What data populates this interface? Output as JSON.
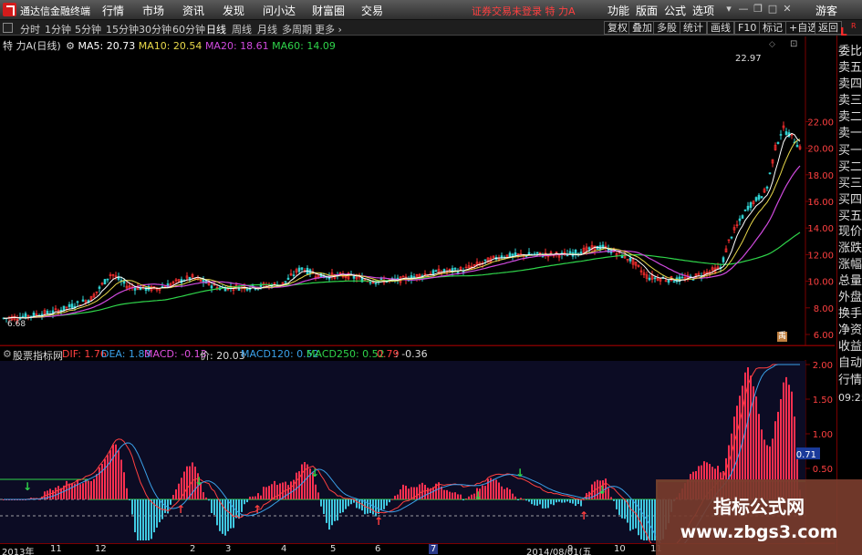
{
  "app": {
    "title": "通达信金融终端"
  },
  "menu": [
    "行情",
    "市场",
    "资讯",
    "发现",
    "问小达",
    "财富圈",
    "交易"
  ],
  "notice": "证券交易未登录  特 力A",
  "right_menu": [
    "功能",
    "版面",
    "公式",
    "选项"
  ],
  "guest": "游客",
  "periods": [
    "分时",
    "1分钟",
    "5分钟",
    "15分钟",
    "30分钟",
    "60分钟",
    "日线",
    "周线",
    "月线",
    "多周期",
    "更多 ›"
  ],
  "active_period": "日线",
  "right_tools": [
    "复权",
    "叠加",
    "多股",
    "统计",
    "画线",
    "F10",
    "标记",
    "+自选",
    "返回"
  ],
  "stock": {
    "name": "特 力A",
    "period_label": "(日线)",
    "ma5": "MA5: 20.73",
    "ma10": "MA10: 20.54",
    "ma20": "MA20: 18.61",
    "ma60": "MA60: 14.09"
  },
  "price_axis": [
    "22.00",
    "20.00",
    "18.00",
    "16.00",
    "14.00",
    "12.00",
    "10.00",
    "8.00",
    "6.00"
  ],
  "annotations": {
    "high": "22.97",
    "low": "6.68"
  },
  "indicator": {
    "name": "股票指标网",
    "dif": "DIF: 1.76",
    "dea": "DEA: 1.83",
    "macd": "MACD: -0.13",
    "price": "价: 20.03",
    "macd120": "MACD120: 0.52",
    "macd250": "MACD250: 0.52",
    "v1": "0.79",
    "v2": ": -0.36"
  },
  "ind_axis": [
    "2.00",
    "1.50",
    "1.00",
    "0.71",
    "0.50"
  ],
  "xaxis": [
    "2013年",
    "11",
    "12",
    "2",
    "3",
    "4",
    "5",
    "6",
    "7",
    "2014/08/01(五",
    "9",
    "10",
    "11",
    "12"
  ],
  "sidebar": {
    "top_l": "L",
    "top_r": "R",
    "items": [
      "委比",
      "卖五",
      "卖四",
      "卖三",
      "卖二",
      "卖一",
      "买一",
      "买二",
      "买三",
      "买四",
      "买五",
      "现价",
      "涨跌",
      "涨幅",
      "总量",
      "外盘",
      "换手",
      "净资",
      "收益",
      "自动",
      "行情",
      "09:25"
    ]
  },
  "watermark": {
    "line1": "指标公式网",
    "line2": "www.zbgs3.com"
  },
  "colors": {
    "ma5": "#ffffff",
    "ma10": "#e8d84a",
    "ma20": "#d04adf",
    "ma60": "#2fd44a",
    "up": "#ff3030",
    "down": "#30d0d0",
    "dif": "#ff4040",
    "dea": "#3aa0e8",
    "macd": "#e050e0"
  }
}
